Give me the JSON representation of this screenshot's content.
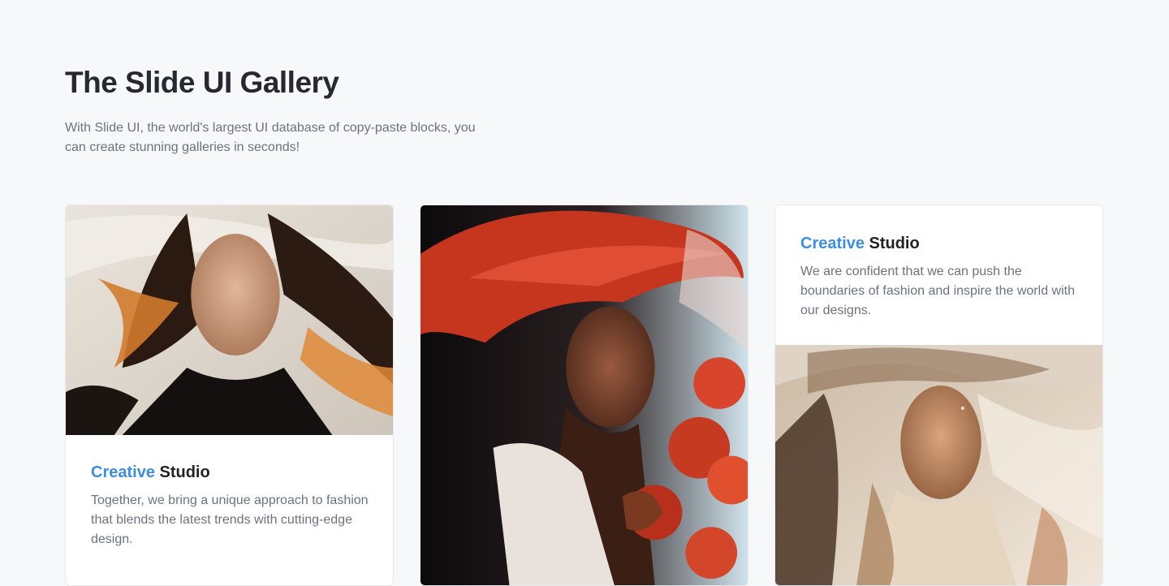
{
  "header": {
    "title": "The Slide UI Gallery",
    "subtitle": "With Slide UI, the world's largest UI database of copy-paste blocks, you can create stunning galleries in seconds!"
  },
  "cards": [
    {
      "accent_word": "Creative",
      "title_rest": "Studio",
      "description": "Together, we bring a unique approach to fashion that blends the latest trends with cutting-edge design.",
      "image": "portrait-flowing-hair-photo"
    },
    {
      "image": "portrait-red-hat-roses-photo"
    },
    {
      "accent_word": "Creative",
      "title_rest": "Studio",
      "description": "We are confident that we can push the boundaries of fashion and inspire the world with our designs.",
      "image": "portrait-sheer-veil-photo"
    }
  ],
  "colors": {
    "accent": "#3b8fe3",
    "background": "#f7f8fa",
    "heading": "#262a30",
    "muted": "#6b7280"
  }
}
